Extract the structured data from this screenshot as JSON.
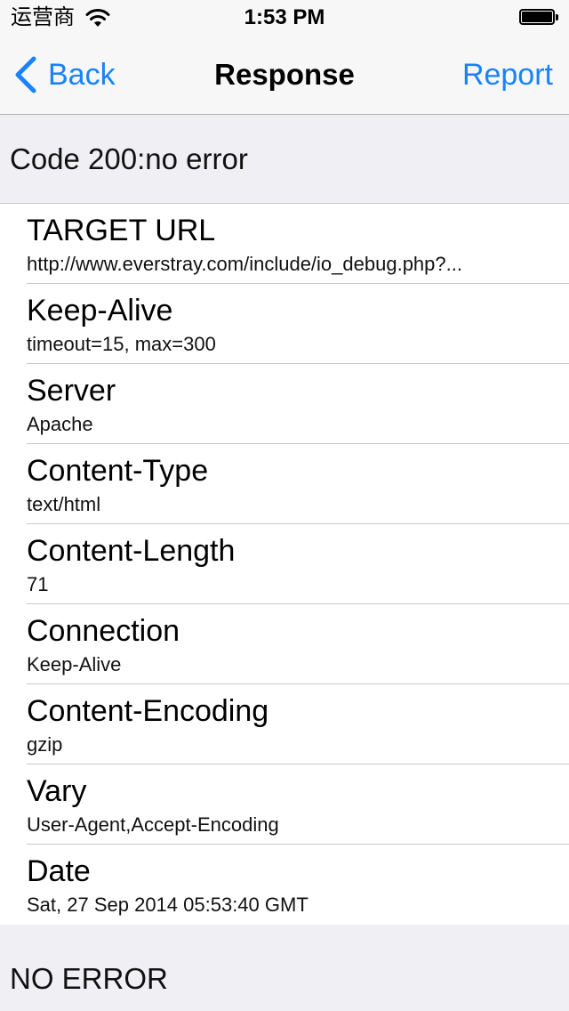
{
  "status_bar": {
    "carrier": "运营商",
    "time": "1:53 PM"
  },
  "nav": {
    "back_label": "Back",
    "title": "Response",
    "report_label": "Report"
  },
  "code_header": "Code 200:no error",
  "headers": [
    {
      "name": "TARGET URL",
      "value": "http://www.everstray.com/include/io_debug.php?..."
    },
    {
      "name": "Keep-Alive",
      "value": "timeout=15, max=300"
    },
    {
      "name": "Server",
      "value": "Apache"
    },
    {
      "name": "Content-Type",
      "value": "text/html"
    },
    {
      "name": "Content-Length",
      "value": "71"
    },
    {
      "name": "Connection",
      "value": "Keep-Alive"
    },
    {
      "name": "Content-Encoding",
      "value": "gzip"
    },
    {
      "name": "Vary",
      "value": "User-Agent,Accept-Encoding"
    },
    {
      "name": "Date",
      "value": "Sat, 27 Sep 2014 05:53:40 GMT"
    }
  ],
  "footer": "NO ERROR",
  "colors": {
    "accent": "#1a82fb",
    "background": "#efeff4",
    "separator": "#c8c7cc"
  },
  "icons": [
    "wifi-icon",
    "battery-icon",
    "chevron-left-icon"
  ]
}
